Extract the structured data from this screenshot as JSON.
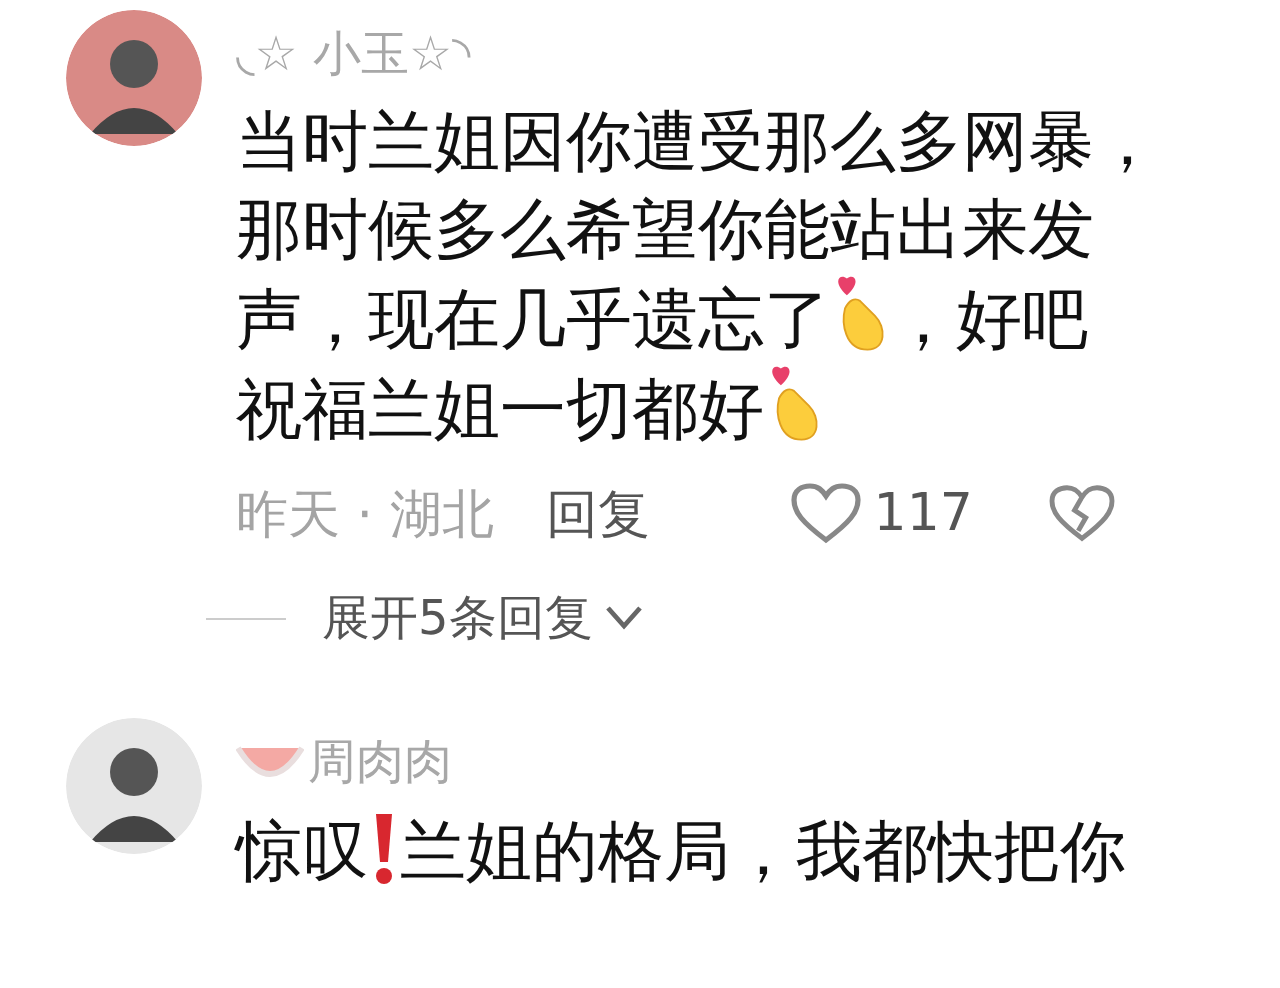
{
  "comments": [
    {
      "name": [
        {
          "kind": "text",
          "text": "◟☆ 小玉☆◝"
        }
      ],
      "lines": [
        [
          {
            "kind": "text",
            "text": "当时兰姐因你遭受那么多网暴，"
          }
        ],
        [
          {
            "kind": "text",
            "text": "那时候多么希望你能站出来发"
          }
        ],
        [
          {
            "kind": "text",
            "text": "声，现在几乎遗忘了"
          },
          {
            "kind": "finger-heart"
          },
          {
            "kind": "text",
            "text": "，好吧"
          }
        ],
        [
          {
            "kind": "text",
            "text": "祝福兰姐一切都好"
          },
          {
            "kind": "finger-heart"
          }
        ]
      ],
      "time": "昨天 · 湖北",
      "reply": "回复",
      "likes": "117",
      "expand": "展开5条回复"
    },
    {
      "name": [
        {
          "kind": "watermelon"
        },
        {
          "kind": "text",
          "text": "周肉肉"
        }
      ],
      "lines": [
        [
          {
            "kind": "text",
            "text": "惊叹"
          },
          {
            "kind": "exclamation"
          },
          {
            "kind": "text",
            "text": "兰姐的格局，我都快把你"
          }
        ]
      ]
    }
  ]
}
